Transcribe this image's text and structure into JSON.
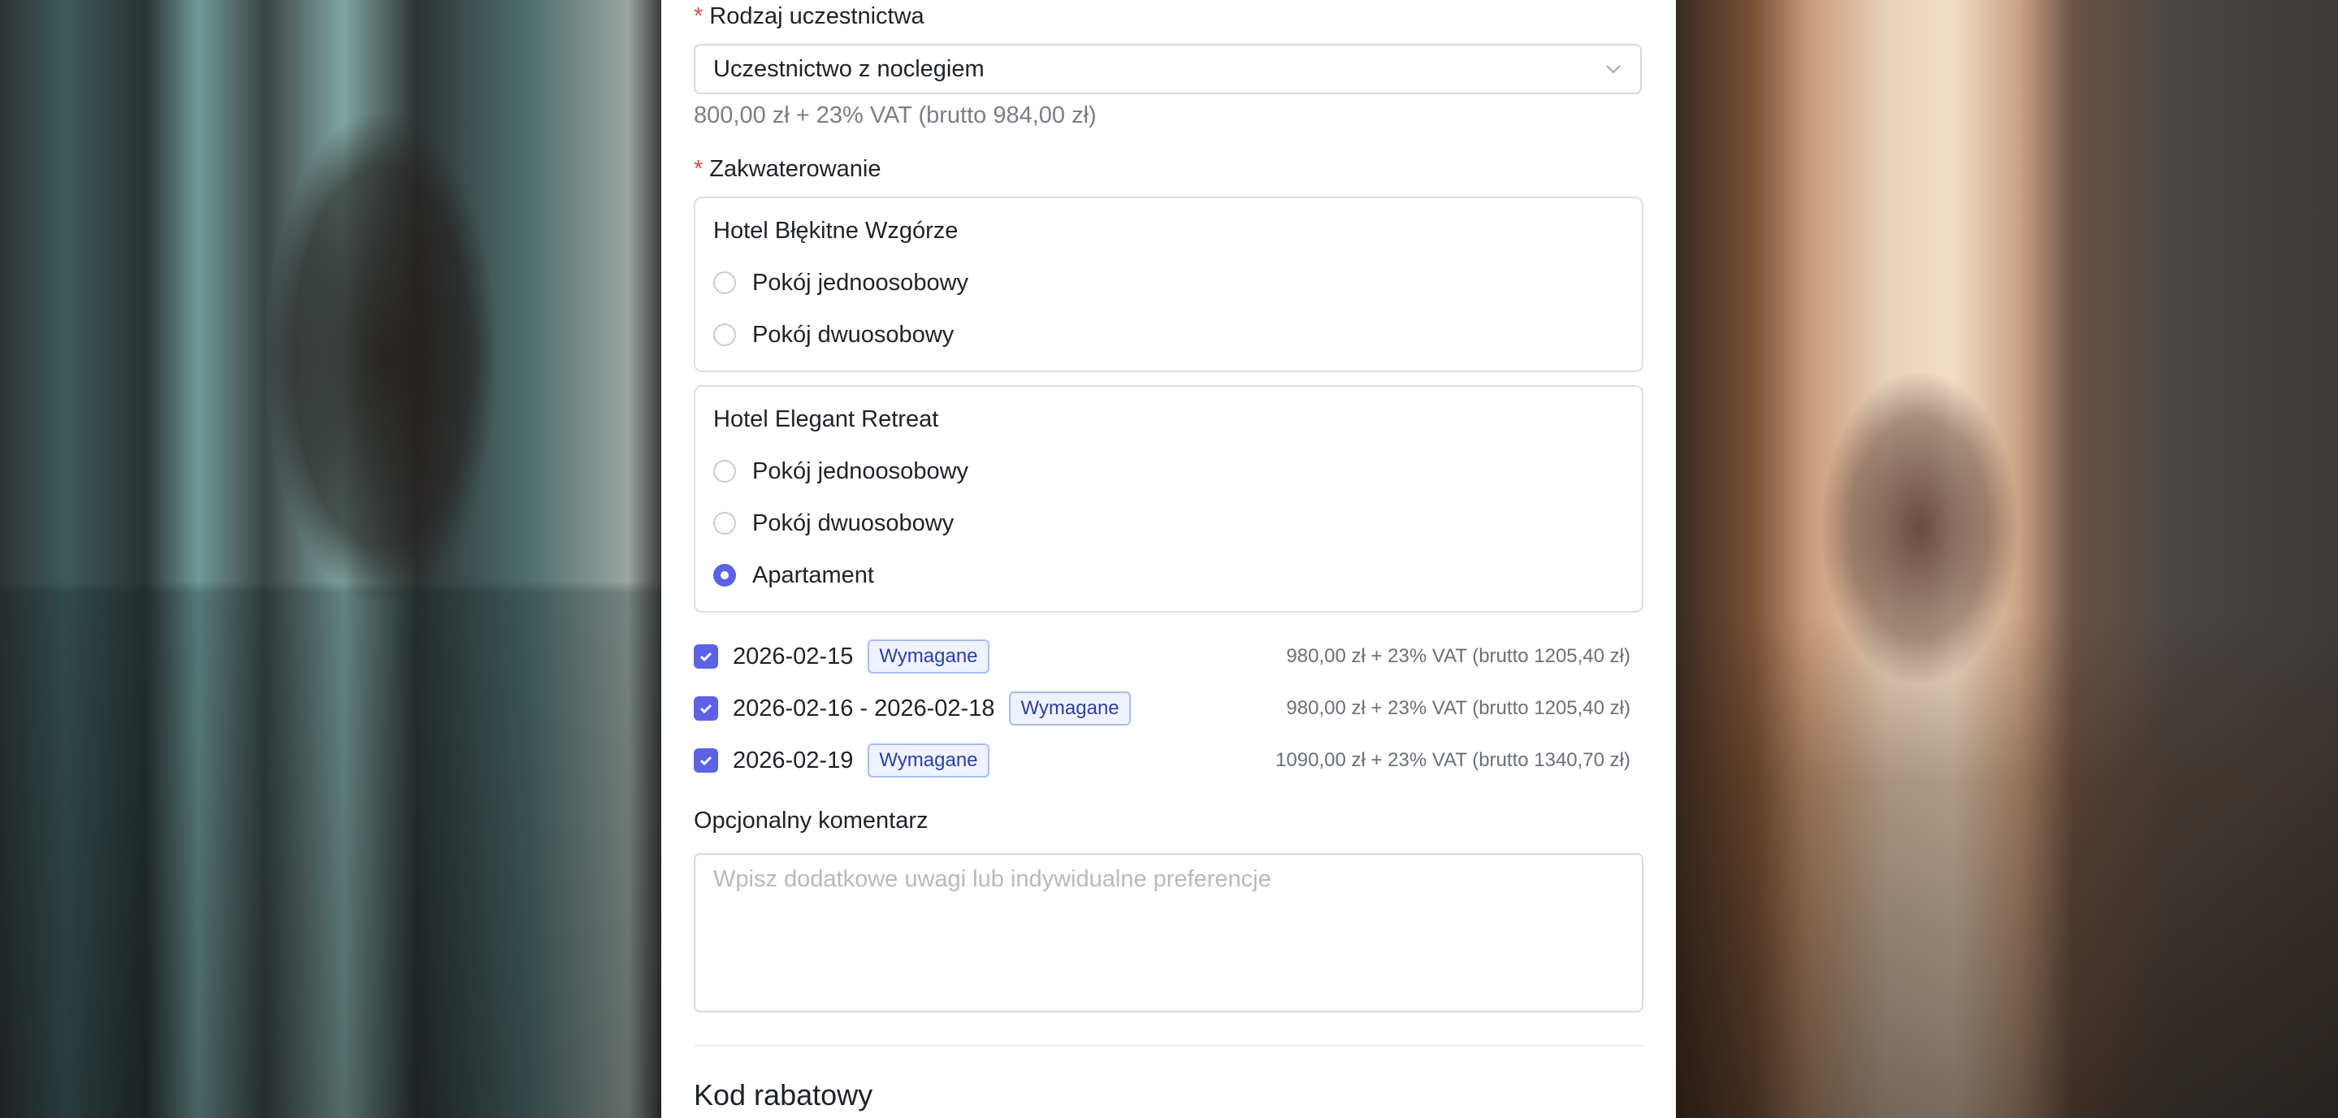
{
  "participation": {
    "label": "Rodzaj uczestnictwa",
    "required_mark": "*",
    "selected": "Uczestnictwo z noclegiem",
    "price_note": "800,00 zł + 23% VAT (brutto 984,00 zł)"
  },
  "accommodation": {
    "label": "Zakwaterowanie",
    "required_mark": "*",
    "hotels": [
      {
        "name": "Hotel Błękitne Wzgórze",
        "options": [
          {
            "label": "Pokój jednoosobowy",
            "checked": false
          },
          {
            "label": "Pokój dwuosobowy",
            "checked": false
          }
        ]
      },
      {
        "name": "Hotel Elegant Retreat",
        "options": [
          {
            "label": "Pokój jednoosobowy",
            "checked": false
          },
          {
            "label": "Pokój dwuosobowy",
            "checked": false
          },
          {
            "label": "Apartament",
            "checked": true
          }
        ]
      }
    ]
  },
  "days": [
    {
      "date": "2026-02-15",
      "badge": "Wymagane",
      "price": "980,00 zł + 23% VAT (brutto 1205,40 zł)",
      "checked": true
    },
    {
      "date": "2026-02-16 - 2026-02-18",
      "badge": "Wymagane",
      "price": "980,00 zł + 23% VAT (brutto 1205,40 zł)",
      "checked": true
    },
    {
      "date": "2026-02-19",
      "badge": "Wymagane",
      "price": "1090,00 zł + 23% VAT (brutto 1340,70 zł)",
      "checked": true
    }
  ],
  "comment": {
    "label": "Opcjonalny komentarz",
    "placeholder": "Wpisz dodatkowe uwagi lub indywidualne preferencje"
  },
  "discount": {
    "title": "Kod rabatowy"
  },
  "colors": {
    "accent": "#5b62e6",
    "required": "#e5484d",
    "badge_text": "#2f3f9e"
  }
}
